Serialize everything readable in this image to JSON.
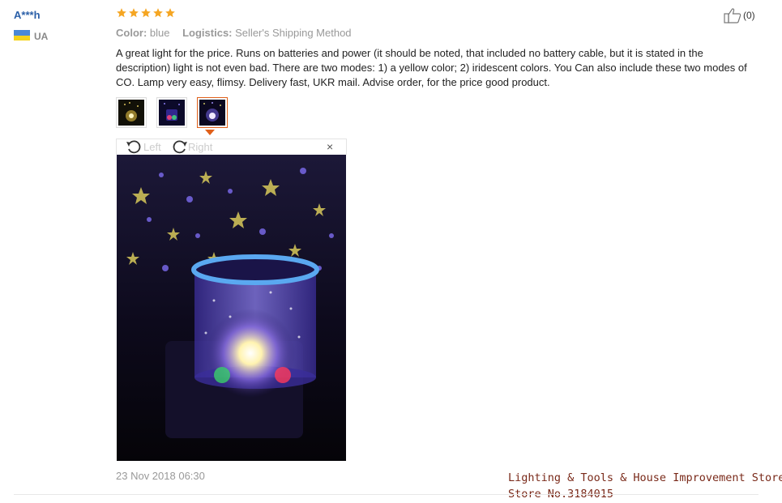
{
  "reviewer": {
    "name": "A***h",
    "country": "UA"
  },
  "rating": {
    "stars": 5,
    "max": 5,
    "color": "#f5a623"
  },
  "meta": {
    "color_label": "Color:",
    "color_value": "blue",
    "logistics_label": "Logistics:",
    "logistics_value": "Seller's Shipping Method"
  },
  "helpful": {
    "count": "(0)",
    "icon": "thumbs-up-icon"
  },
  "review": {
    "text": "A great light for the price. Runs on batteries and power (it should be noted, that included no battery cable, but it is stated in the description) light is not even bad. There are two modes: 1) a yellow color; 2) iridescent colors. You Can also include these two modes of CO. Lamp very easy, flimsy. Delivery fast, UKR mail. Advise order, for the price good product."
  },
  "thumbnails": {
    "count": 3,
    "active_index": 2
  },
  "viewer": {
    "left_label": "Left",
    "right_label": "Right",
    "close_symbol": "×"
  },
  "date": "23 Nov 2018 06:30",
  "store": {
    "line1": "Lighting & Tools & House Improvement Store",
    "line2": "Store No.3184015"
  },
  "colors": {
    "name_blue": "#2a5fa8",
    "accent_orange": "#e0601a",
    "store_text": "#7a2a1a"
  }
}
